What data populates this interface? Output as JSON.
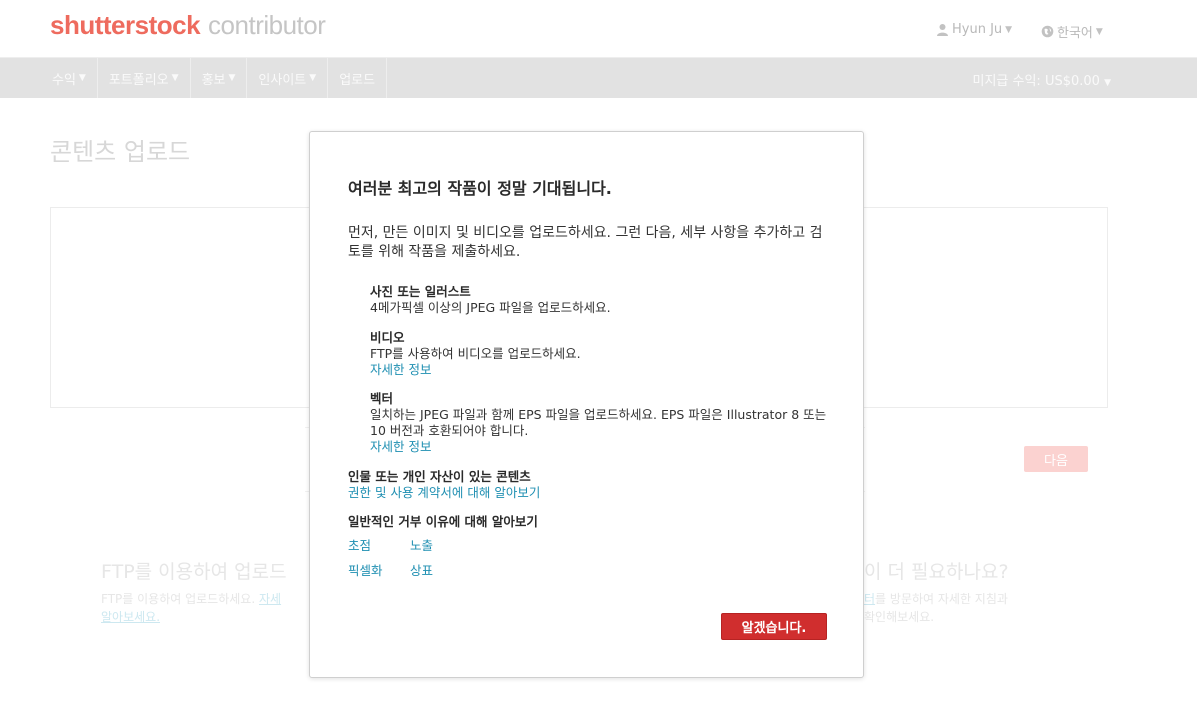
{
  "header": {
    "logo_brand": "shutterstock",
    "logo_sub": "contributor",
    "user_label": "Hyun Ju",
    "language_label": "한국어"
  },
  "nav": {
    "items": [
      {
        "label": "수익"
      },
      {
        "label": "포트폴리오"
      },
      {
        "label": "홍보"
      },
      {
        "label": "인사이트"
      },
      {
        "label": "업로드"
      }
    ],
    "unpaid_earnings": "미지급 수익: US$0.00"
  },
  "page": {
    "title": "콘텐츠 업로드",
    "next_button": "다음",
    "ftp_heading": "FTP를 이용하여 업로드",
    "ftp_text_1": "FTP를 이용하여 업로드하세요.",
    "ftp_link_1": "자세",
    "ftp_link_2": "알아보세요.",
    "help_heading": "이 더 필요하나요?",
    "help_link": "터",
    "help_text_1": "를 방문하여 자세한 지침과",
    "help_text_2": "확인해보세요."
  },
  "modal": {
    "title": "여러분 최고의 작품이 정말 기대됩니다.",
    "intro": "먼저, 만든 이미지 및 비디오를 업로드하세요. 그런 다음, 세부 사항을 추가하고 검토를 위해 작품을 제출하세요.",
    "photo": {
      "heading": "사진 또는 일러스트",
      "text": "4메가픽셀 이상의 JPEG 파일을 업로드하세요."
    },
    "video": {
      "heading": "비디오",
      "text": "FTP를 사용하여 비디오를 업로드하세요.",
      "link": "자세한 정보"
    },
    "vector": {
      "heading": "벡터",
      "text": "일치하는 JPEG 파일과 함께 EPS 파일을 업로드하세요. EPS 파일은 Illustrator 8 또는 10 버전과 호환되어야 합니다.",
      "link": "자세한 정보"
    },
    "people": {
      "heading": "인물 또는 개인 자산이 있는 콘텐츠",
      "link": "권한 및 사용 계약서에 대해 알아보기"
    },
    "rejection": {
      "heading": "일반적인 거부 이유에 대해 알아보기",
      "reasons": [
        "초점",
        "노출",
        "픽셀화",
        "상표"
      ]
    },
    "ok_button": "알겠습니다."
  }
}
